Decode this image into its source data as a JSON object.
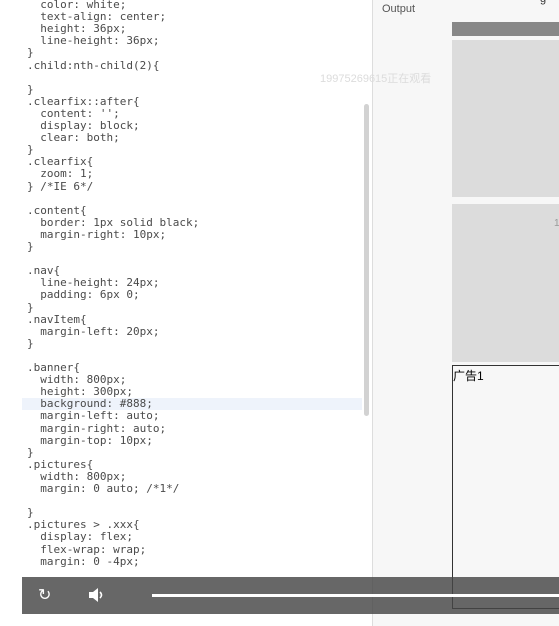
{
  "editor": {
    "lines": [
      "  color: white;",
      "  text-align: center;",
      "  height: 36px;",
      "  line-height: 36px;",
      "}",
      ".child:nth-child(2){",
      "",
      "}",
      ".clearfix::after{",
      "  content: '';",
      "  display: block;",
      "  clear: both;",
      "}",
      ".clearfix{",
      "  zoom: 1;",
      "} /*IE 6*/",
      "",
      ".content{",
      "  border: 1px solid black;",
      "  margin-right: 10px;",
      "}",
      "",
      ".nav{",
      "  line-height: 24px;",
      "  padding: 6px 0;",
      "}",
      ".navItem{",
      "  margin-left: 20px;",
      "}",
      "",
      ".banner{",
      "  width: 800px;",
      "  height: 300px;",
      "  background: #888;",
      "  margin-left: auto;",
      "  margin-right: auto;",
      "  margin-top: 10px;",
      "}",
      ".pictures{",
      "  width: 800px;",
      "  margin: 0 auto; /*1*/",
      "",
      "}",
      ".pictures > .xxx{",
      "  display: flex;",
      "  flex-wrap: wrap;",
      "  margin: 0 -4px;"
    ],
    "highlighted_line_index": 33
  },
  "output": {
    "label": "Output",
    "watermark": "19975269615正在观看",
    "top_glyph": "g",
    "ad_label": "广告1",
    "box2_mark": "1",
    "colors": {
      "banner": "#888888",
      "box": "#dcdcdc",
      "pane": "#f7f7f7"
    }
  },
  "player": {
    "replay_icon": "replay-icon",
    "volume_icon": "volume-icon",
    "progress": 1.0
  }
}
